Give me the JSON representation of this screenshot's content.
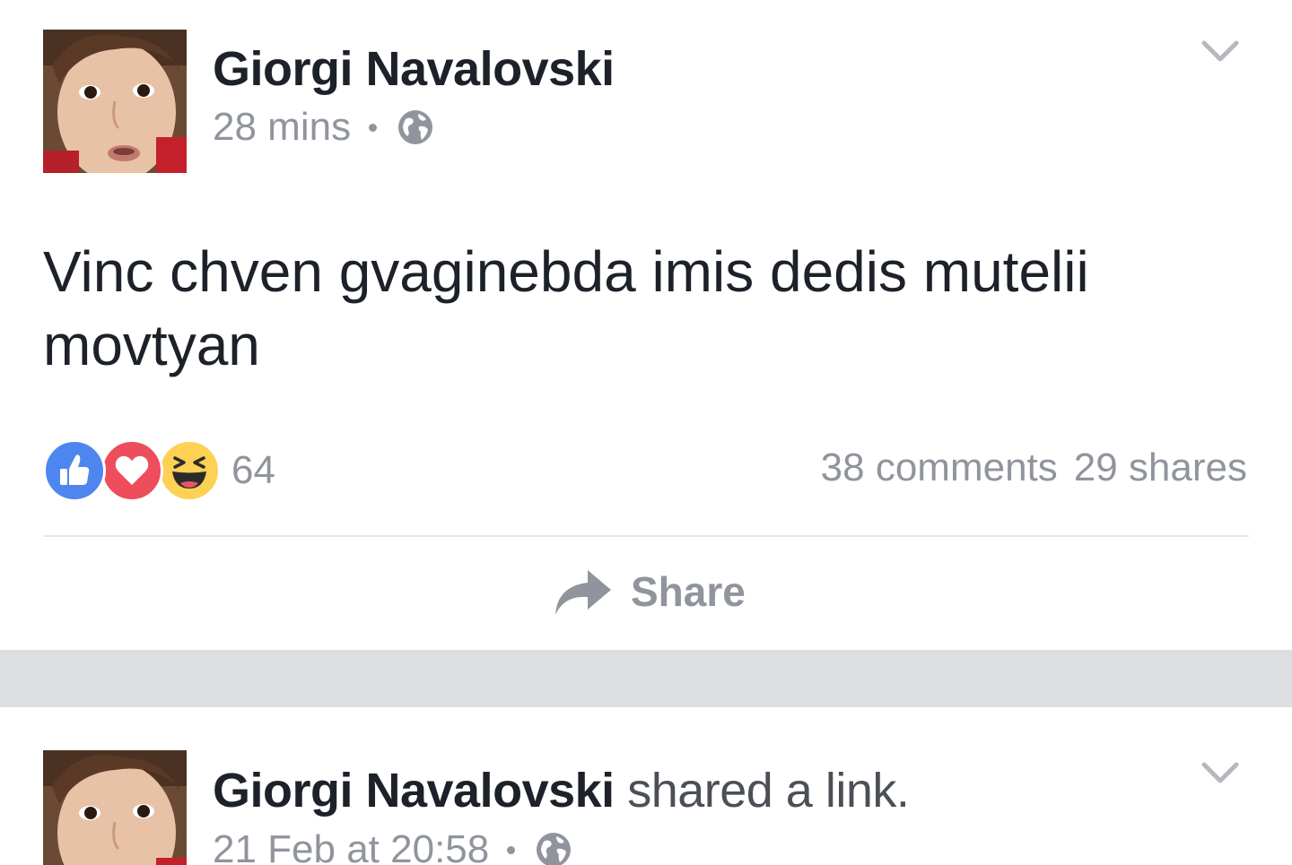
{
  "post1": {
    "author": "Giorgi Navalovski",
    "time": "28 mins",
    "privacy_icon": "globe-icon",
    "menu_icon": "chevron-down-icon",
    "text": "Vinc chven gvaginebda imis dedis mutelii movtyan",
    "reactions": {
      "icons": [
        "like-reaction-icon",
        "love-reaction-icon",
        "haha-reaction-icon"
      ],
      "count": "64"
    },
    "comments": "38 comments",
    "shares": "29 shares",
    "share_label": "Share"
  },
  "post2": {
    "author": "Giorgi Navalovski",
    "action": " shared a link.",
    "time": "21 Feb at 20:58",
    "privacy_icon": "globe-icon",
    "menu_icon": "chevron-down-icon"
  },
  "colors": {
    "like_blue": "#4e86f0",
    "love_red": "#ee4d5c",
    "haha_yellow": "#fcd154",
    "divider_gray": "#dcdee2",
    "meta_gray": "#90949c",
    "text_dark": "#1d2129"
  }
}
